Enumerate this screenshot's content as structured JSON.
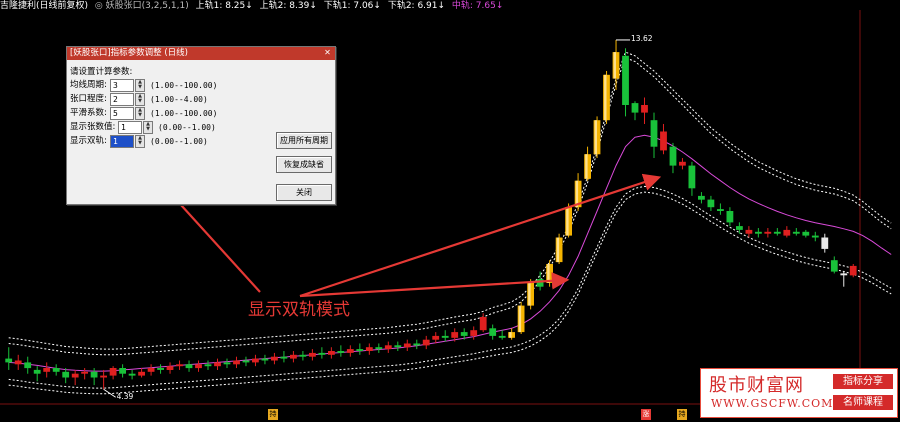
{
  "header": {
    "stock_name": "吉隆捷利(日线前复权)",
    "indicator_name": "◎ 妖股张口(3,2,5,1,1)",
    "upper1": "上轨1: 8.25↓",
    "upper2": "上轨2: 8.39↓",
    "lower1": "下轨1: 7.06↓",
    "lower2": "下轨2: 6.91↓",
    "mid": "中轨: 7.65↓",
    "colors": {
      "upper1": "#ffffff",
      "upper2": "#ffffff",
      "lower1": "#ffffff",
      "lower2": "#ffffff",
      "mid": "#d94ad9",
      "name": "#ffffff",
      "indicator": "#bbbbbb"
    }
  },
  "dialog": {
    "title": "[妖股张口]指标参数调整 (日线)",
    "calc_label": "请设置计算参数:",
    "params": [
      {
        "name": "均线周期:",
        "value": "3",
        "range": "(1.00--100.00)"
      },
      {
        "name": "张口程度:",
        "value": "2",
        "range": "(1.00--4.00)"
      },
      {
        "name": "平滑系数:",
        "value": "5",
        "range": "(1.00--100.00)"
      },
      {
        "name": "显示张数值:",
        "value": "1",
        "range": "(0.00--1.00)"
      },
      {
        "name": "显示双轨:",
        "value": "1",
        "range": "(0.00--1.00)"
      }
    ],
    "buttons": {
      "apply_all": "应用所有周期",
      "restore_default": "恢复成缺省",
      "close": "关闭"
    }
  },
  "annotation": {
    "text": "显示双轨模式",
    "color": "#e53935"
  },
  "price_labels": {
    "high": "13.62",
    "low": "4.39"
  },
  "date_tags": {
    "t1": "持",
    "t2": "涨",
    "t3": "持"
  },
  "watermark": {
    "title": "股市财富网",
    "url": "WWW.GSCFW.COM",
    "badge1": "指标分享",
    "badge2": "名师课程"
  },
  "chart_data": {
    "type": "candlestick",
    "y_range": [
      4.0,
      14.2
    ],
    "candles": [
      {
        "o": 5.2,
        "c": 5.1,
        "h": 5.5,
        "l": 4.9
      },
      {
        "o": 5.05,
        "c": 5.15,
        "h": 5.3,
        "l": 4.9
      },
      {
        "o": 5.1,
        "c": 4.95,
        "h": 5.25,
        "l": 4.8
      },
      {
        "o": 4.9,
        "c": 4.8,
        "h": 5.0,
        "l": 4.6
      },
      {
        "o": 4.85,
        "c": 4.95,
        "h": 5.1,
        "l": 4.7
      },
      {
        "o": 4.95,
        "c": 4.85,
        "h": 5.05,
        "l": 4.75
      },
      {
        "o": 4.85,
        "c": 4.7,
        "h": 4.95,
        "l": 4.55
      },
      {
        "o": 4.7,
        "c": 4.8,
        "h": 4.9,
        "l": 4.5
      },
      {
        "o": 4.8,
        "c": 4.85,
        "h": 4.95,
        "l": 4.65
      },
      {
        "o": 4.85,
        "c": 4.7,
        "h": 4.95,
        "l": 4.5
      },
      {
        "o": 4.7,
        "c": 4.75,
        "h": 4.9,
        "l": 4.39
      },
      {
        "o": 4.75,
        "c": 4.95,
        "h": 5.0,
        "l": 4.65
      },
      {
        "o": 4.95,
        "c": 4.8,
        "h": 5.05,
        "l": 4.7
      },
      {
        "o": 4.8,
        "c": 4.75,
        "h": 4.9,
        "l": 4.65
      },
      {
        "o": 4.75,
        "c": 4.85,
        "h": 4.95,
        "l": 4.7
      },
      {
        "o": 4.85,
        "c": 4.95,
        "h": 5.05,
        "l": 4.75
      },
      {
        "o": 4.95,
        "c": 4.9,
        "h": 5.05,
        "l": 4.8
      },
      {
        "o": 4.9,
        "c": 5.0,
        "h": 5.1,
        "l": 4.8
      },
      {
        "o": 5.0,
        "c": 5.05,
        "h": 5.15,
        "l": 4.9
      },
      {
        "o": 5.05,
        "c": 4.95,
        "h": 5.15,
        "l": 4.85
      },
      {
        "o": 4.95,
        "c": 5.05,
        "h": 5.15,
        "l": 4.85
      },
      {
        "o": 5.05,
        "c": 5.0,
        "h": 5.15,
        "l": 4.9
      },
      {
        "o": 5.0,
        "c": 5.1,
        "h": 5.2,
        "l": 4.9
      },
      {
        "o": 5.1,
        "c": 5.05,
        "h": 5.2,
        "l": 4.95
      },
      {
        "o": 5.05,
        "c": 5.15,
        "h": 5.25,
        "l": 4.95
      },
      {
        "o": 5.15,
        "c": 5.1,
        "h": 5.25,
        "l": 5.0
      },
      {
        "o": 5.1,
        "c": 5.2,
        "h": 5.3,
        "l": 5.0
      },
      {
        "o": 5.2,
        "c": 5.15,
        "h": 5.3,
        "l": 5.05
      },
      {
        "o": 5.15,
        "c": 5.25,
        "h": 5.35,
        "l": 5.05
      },
      {
        "o": 5.25,
        "c": 5.2,
        "h": 5.4,
        "l": 5.1
      },
      {
        "o": 5.2,
        "c": 5.3,
        "h": 5.4,
        "l": 5.1
      },
      {
        "o": 5.3,
        "c": 5.25,
        "h": 5.4,
        "l": 5.15
      },
      {
        "o": 5.25,
        "c": 5.35,
        "h": 5.45,
        "l": 5.15
      },
      {
        "o": 5.35,
        "c": 5.3,
        "h": 5.5,
        "l": 5.2
      },
      {
        "o": 5.3,
        "c": 5.4,
        "h": 5.5,
        "l": 5.2
      },
      {
        "o": 5.4,
        "c": 5.35,
        "h": 5.55,
        "l": 5.25
      },
      {
        "o": 5.35,
        "c": 5.45,
        "h": 5.55,
        "l": 5.25
      },
      {
        "o": 5.45,
        "c": 5.4,
        "h": 5.6,
        "l": 5.3
      },
      {
        "o": 5.4,
        "c": 5.5,
        "h": 5.6,
        "l": 5.3
      },
      {
        "o": 5.5,
        "c": 5.45,
        "h": 5.6,
        "l": 5.35
      },
      {
        "o": 5.45,
        "c": 5.55,
        "h": 5.65,
        "l": 5.35
      },
      {
        "o": 5.55,
        "c": 5.5,
        "h": 5.65,
        "l": 5.4
      },
      {
        "o": 5.5,
        "c": 5.6,
        "h": 5.7,
        "l": 5.4
      },
      {
        "o": 5.6,
        "c": 5.55,
        "h": 5.7,
        "l": 5.45
      },
      {
        "o": 5.55,
        "c": 5.7,
        "h": 5.8,
        "l": 5.45
      },
      {
        "o": 5.7,
        "c": 5.8,
        "h": 5.9,
        "l": 5.6
      },
      {
        "o": 5.8,
        "c": 5.75,
        "h": 5.95,
        "l": 5.65
      },
      {
        "o": 5.75,
        "c": 5.9,
        "h": 6.0,
        "l": 5.65
      },
      {
        "o": 5.9,
        "c": 5.8,
        "h": 6.0,
        "l": 5.7
      },
      {
        "o": 5.8,
        "c": 5.95,
        "h": 6.05,
        "l": 5.7
      },
      {
        "o": 5.95,
        "c": 6.3,
        "h": 6.4,
        "l": 5.9
      },
      {
        "o": 6.0,
        "c": 5.8,
        "h": 6.1,
        "l": 5.7
      },
      {
        "o": 5.8,
        "c": 5.75,
        "h": 5.95,
        "l": 5.7
      },
      {
        "o": 5.75,
        "c": 5.9,
        "h": 6.0,
        "l": 5.7
      },
      {
        "o": 5.9,
        "c": 6.6,
        "h": 6.7,
        "l": 5.85
      },
      {
        "o": 6.6,
        "c": 7.2,
        "h": 7.3,
        "l": 6.5
      },
      {
        "o": 7.3,
        "c": 7.1,
        "h": 7.5,
        "l": 7.0
      },
      {
        "o": 7.2,
        "c": 7.7,
        "h": 7.8,
        "l": 7.1
      },
      {
        "o": 7.75,
        "c": 8.4,
        "h": 8.5,
        "l": 7.7
      },
      {
        "o": 8.45,
        "c": 9.2,
        "h": 9.3,
        "l": 8.4
      },
      {
        "o": 9.2,
        "c": 9.9,
        "h": 10.1,
        "l": 9.1
      },
      {
        "o": 9.95,
        "c": 10.6,
        "h": 10.8,
        "l": 9.9
      },
      {
        "o": 10.6,
        "c": 11.5,
        "h": 11.6,
        "l": 10.5
      },
      {
        "o": 11.5,
        "c": 12.7,
        "h": 12.8,
        "l": 11.4
      },
      {
        "o": 12.6,
        "c": 13.3,
        "h": 13.62,
        "l": 12.3
      },
      {
        "o": 13.2,
        "c": 11.9,
        "h": 13.4,
        "l": 11.6
      },
      {
        "o": 11.95,
        "c": 11.7,
        "h": 12.0,
        "l": 11.5
      },
      {
        "o": 11.7,
        "c": 11.9,
        "h": 12.1,
        "l": 11.4
      },
      {
        "o": 11.5,
        "c": 10.8,
        "h": 11.7,
        "l": 10.5
      },
      {
        "o": 10.7,
        "c": 11.2,
        "h": 11.4,
        "l": 10.6
      },
      {
        "o": 10.8,
        "c": 10.3,
        "h": 10.9,
        "l": 10.1
      },
      {
        "o": 10.3,
        "c": 10.4,
        "h": 10.5,
        "l": 10.2
      },
      {
        "o": 10.3,
        "c": 9.7,
        "h": 10.4,
        "l": 9.5
      },
      {
        "o": 9.5,
        "c": 9.4,
        "h": 9.6,
        "l": 9.3
      },
      {
        "o": 9.4,
        "c": 9.2,
        "h": 9.5,
        "l": 9.1
      },
      {
        "o": 9.15,
        "c": 9.1,
        "h": 9.3,
        "l": 9.0
      },
      {
        "o": 9.1,
        "c": 8.8,
        "h": 9.2,
        "l": 8.7
      },
      {
        "o": 8.7,
        "c": 8.6,
        "h": 8.8,
        "l": 8.5
      },
      {
        "o": 8.5,
        "c": 8.6,
        "h": 8.7,
        "l": 8.4
      },
      {
        "o": 8.55,
        "c": 8.5,
        "h": 8.65,
        "l": 8.4
      },
      {
        "o": 8.5,
        "c": 8.55,
        "h": 8.65,
        "l": 8.4
      },
      {
        "o": 8.55,
        "c": 8.5,
        "h": 8.65,
        "l": 8.45
      },
      {
        "o": 8.45,
        "c": 8.6,
        "h": 8.7,
        "l": 8.4
      },
      {
        "o": 8.55,
        "c": 8.5,
        "h": 8.65,
        "l": 8.45
      },
      {
        "o": 8.55,
        "c": 8.45,
        "h": 8.6,
        "l": 8.4
      },
      {
        "o": 8.45,
        "c": 8.4,
        "h": 8.55,
        "l": 8.3
      },
      {
        "o": 8.4,
        "c": 8.1,
        "h": 8.5,
        "l": 8.0
      },
      {
        "o": 7.8,
        "c": 7.5,
        "h": 7.9,
        "l": 7.45
      },
      {
        "o": 7.45,
        "c": 7.4,
        "h": 7.5,
        "l": 7.1
      },
      {
        "o": 7.4,
        "c": 7.65,
        "h": 7.7,
        "l": 7.35
      }
    ],
    "upper_band_2": [
      5.75,
      5.72,
      5.68,
      5.64,
      5.6,
      5.56,
      5.52,
      5.5,
      5.48,
      5.46,
      5.45,
      5.45,
      5.46,
      5.48,
      5.5,
      5.52,
      5.54,
      5.56,
      5.58,
      5.6,
      5.62,
      5.64,
      5.66,
      5.68,
      5.7,
      5.72,
      5.74,
      5.76,
      5.78,
      5.8,
      5.82,
      5.84,
      5.86,
      5.88,
      5.9,
      5.92,
      5.94,
      5.96,
      5.98,
      6.0,
      6.02,
      6.05,
      6.08,
      6.11,
      6.15,
      6.2,
      6.25,
      6.3,
      6.34,
      6.38,
      6.45,
      6.55,
      6.62,
      6.7,
      6.85,
      7.1,
      7.4,
      7.75,
      8.2,
      8.7,
      9.3,
      10.0,
      10.8,
      11.7,
      12.6,
      13.3,
      13.2,
      13.0,
      12.8,
      12.55,
      12.3,
      12.05,
      11.8,
      11.55,
      11.3,
      11.1,
      10.9,
      10.72,
      10.55,
      10.4,
      10.28,
      10.16,
      10.05,
      9.95,
      9.87,
      9.8,
      9.75,
      9.7,
      9.62,
      9.52,
      9.35,
      9.15,
      8.95,
      8.78
    ],
    "upper_band_1": [
      5.6,
      5.57,
      5.53,
      5.49,
      5.45,
      5.41,
      5.37,
      5.35,
      5.33,
      5.31,
      5.3,
      5.3,
      5.31,
      5.33,
      5.35,
      5.37,
      5.39,
      5.41,
      5.43,
      5.45,
      5.47,
      5.49,
      5.51,
      5.53,
      5.55,
      5.57,
      5.59,
      5.61,
      5.63,
      5.65,
      5.67,
      5.69,
      5.71,
      5.73,
      5.75,
      5.77,
      5.79,
      5.81,
      5.83,
      5.85,
      5.87,
      5.9,
      5.93,
      5.96,
      6.0,
      6.05,
      6.1,
      6.15,
      6.19,
      6.23,
      6.3,
      6.4,
      6.47,
      6.55,
      6.7,
      6.95,
      7.25,
      7.6,
      8.05,
      8.55,
      9.15,
      9.85,
      10.65,
      11.55,
      12.45,
      13.15,
      13.05,
      12.85,
      12.65,
      12.4,
      12.15,
      11.9,
      11.65,
      11.4,
      11.15,
      10.95,
      10.75,
      10.57,
      10.4,
      10.25,
      10.13,
      10.01,
      9.9,
      9.8,
      9.72,
      9.65,
      9.6,
      9.55,
      9.47,
      9.37,
      9.2,
      9.0,
      8.8,
      8.63
    ],
    "mid_band": [
      5.1,
      5.08,
      5.05,
      5.02,
      4.98,
      4.94,
      4.91,
      4.89,
      4.88,
      4.87,
      4.87,
      4.88,
      4.9,
      4.92,
      4.94,
      4.96,
      4.98,
      5.0,
      5.02,
      5.04,
      5.06,
      5.08,
      5.1,
      5.12,
      5.14,
      5.16,
      5.18,
      5.2,
      5.22,
      5.24,
      5.26,
      5.28,
      5.3,
      5.32,
      5.34,
      5.36,
      5.38,
      5.4,
      5.42,
      5.44,
      5.46,
      5.48,
      5.51,
      5.54,
      5.58,
      5.62,
      5.66,
      5.7,
      5.74,
      5.78,
      5.84,
      5.9,
      5.95,
      6.0,
      6.1,
      6.25,
      6.45,
      6.7,
      7.0,
      7.4,
      7.9,
      8.5,
      9.1,
      9.7,
      10.3,
      10.8,
      11.05,
      11.1,
      11.05,
      10.95,
      10.82,
      10.66,
      10.48,
      10.28,
      10.08,
      9.9,
      9.72,
      9.56,
      9.42,
      9.3,
      9.19,
      9.09,
      9.0,
      8.92,
      8.85,
      8.79,
      8.74,
      8.69,
      8.63,
      8.56,
      8.45,
      8.3,
      8.12,
      7.95
    ],
    "lower_band_1": [
      4.65,
      4.62,
      4.58,
      4.55,
      4.52,
      4.49,
      4.46,
      4.44,
      4.43,
      4.42,
      4.42,
      4.43,
      4.45,
      4.47,
      4.49,
      4.51,
      4.53,
      4.55,
      4.57,
      4.59,
      4.61,
      4.63,
      4.65,
      4.67,
      4.69,
      4.71,
      4.73,
      4.75,
      4.77,
      4.79,
      4.81,
      4.83,
      4.85,
      4.87,
      4.89,
      4.91,
      4.93,
      4.95,
      4.97,
      4.99,
      5.01,
      5.03,
      5.06,
      5.09,
      5.13,
      5.17,
      5.21,
      5.25,
      5.29,
      5.33,
      5.38,
      5.43,
      5.47,
      5.51,
      5.58,
      5.68,
      5.82,
      6.0,
      6.25,
      6.6,
      7.05,
      7.6,
      8.15,
      8.7,
      9.2,
      9.55,
      9.7,
      9.75,
      9.72,
      9.65,
      9.55,
      9.43,
      9.29,
      9.13,
      8.97,
      8.82,
      8.67,
      8.53,
      8.4,
      8.29,
      8.19,
      8.1,
      8.02,
      7.94,
      7.87,
      7.81,
      7.76,
      7.71,
      7.65,
      7.58,
      7.48,
      7.35,
      7.2,
      7.06
    ],
    "lower_band_2": [
      4.5,
      4.47,
      4.43,
      4.4,
      4.37,
      4.34,
      4.31,
      4.29,
      4.28,
      4.27,
      4.27,
      4.28,
      4.3,
      4.32,
      4.34,
      4.36,
      4.38,
      4.4,
      4.42,
      4.44,
      4.46,
      4.48,
      4.5,
      4.52,
      4.54,
      4.56,
      4.58,
      4.6,
      4.62,
      4.64,
      4.66,
      4.68,
      4.7,
      4.72,
      4.74,
      4.76,
      4.78,
      4.8,
      4.82,
      4.84,
      4.86,
      4.88,
      4.91,
      4.94,
      4.98,
      5.02,
      5.06,
      5.1,
      5.14,
      5.18,
      5.23,
      5.28,
      5.32,
      5.36,
      5.43,
      5.53,
      5.67,
      5.85,
      6.1,
      6.45,
      6.9,
      7.45,
      8.0,
      8.55,
      9.05,
      9.4,
      9.55,
      9.6,
      9.57,
      9.5,
      9.4,
      9.28,
      9.14,
      8.98,
      8.82,
      8.67,
      8.52,
      8.38,
      8.25,
      8.14,
      8.04,
      7.95,
      7.87,
      7.79,
      7.72,
      7.66,
      7.61,
      7.56,
      7.5,
      7.43,
      7.33,
      7.2,
      7.05,
      6.91
    ],
    "highlight_range": [
      51,
      65
    ]
  }
}
